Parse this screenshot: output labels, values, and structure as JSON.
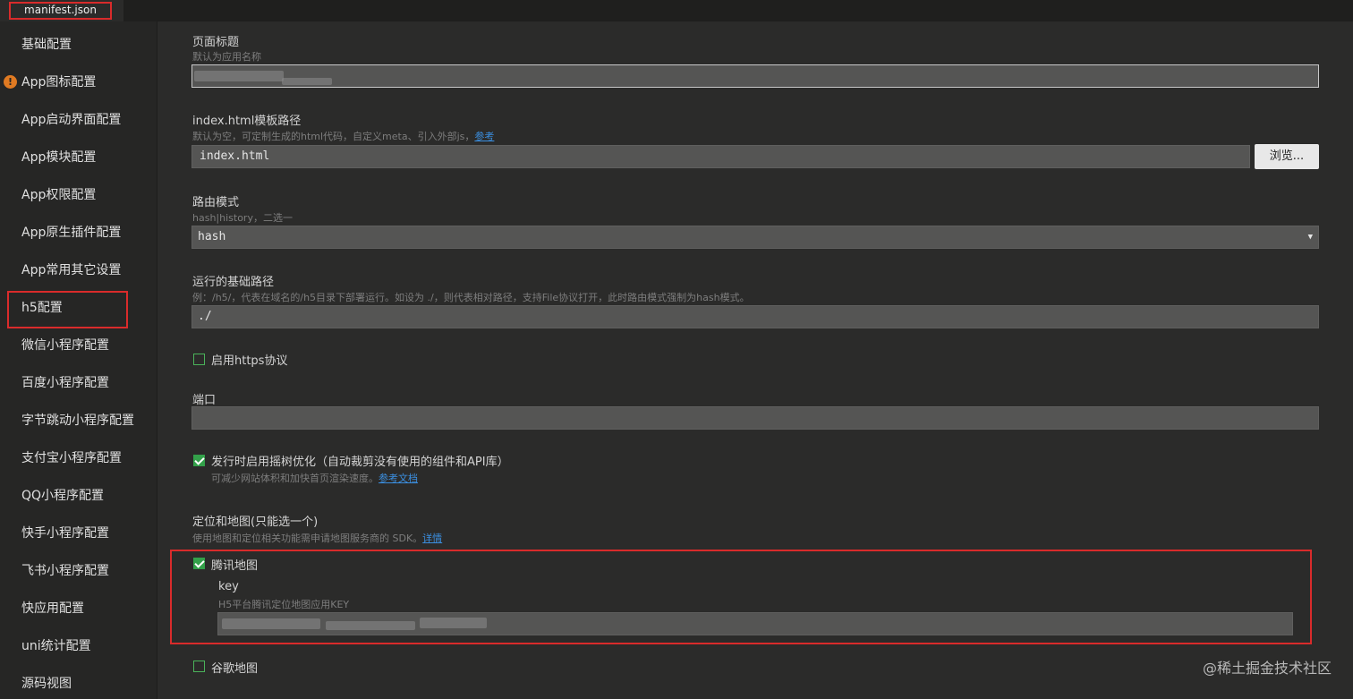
{
  "tab": {
    "label": "manifest.json"
  },
  "sidebar": {
    "items": [
      {
        "label": "基础配置"
      },
      {
        "label": "App图标配置",
        "warning": "!"
      },
      {
        "label": "App启动界面配置"
      },
      {
        "label": "App模块配置"
      },
      {
        "label": "App权限配置"
      },
      {
        "label": "App原生插件配置"
      },
      {
        "label": "App常用其它设置"
      },
      {
        "label": "h5配置",
        "selected": true
      },
      {
        "label": "微信小程序配置"
      },
      {
        "label": "百度小程序配置"
      },
      {
        "label": "字节跳动小程序配置"
      },
      {
        "label": "支付宝小程序配置"
      },
      {
        "label": "QQ小程序配置"
      },
      {
        "label": "快手小程序配置"
      },
      {
        "label": "飞书小程序配置"
      },
      {
        "label": "快应用配置"
      },
      {
        "label": "uni统计配置"
      },
      {
        "label": "源码视图"
      }
    ]
  },
  "form": {
    "title": {
      "label": "页面标题",
      "hint": "默认为应用名称",
      "value": ""
    },
    "template": {
      "label": "index.html模板路径",
      "hint": "默认为空，可定制生成的html代码，自定义meta、引入外部js，",
      "hint_link": "参考",
      "value": "index.html",
      "browse": "浏览..."
    },
    "router": {
      "label": "路由模式",
      "hint": "hash|history，二选一",
      "value": "hash"
    },
    "base": {
      "label": "运行的基础路径",
      "hint": "例：/h5/，代表在域名的/h5目录下部署运行。如设为 ./，则代表相对路径，支持File协议打开，此时路由模式强制为hash模式。",
      "value": "./"
    },
    "https": {
      "label": "启用https协议",
      "checked": false
    },
    "port": {
      "label": "端口",
      "value": ""
    },
    "treeshake": {
      "label": "发行时启用摇树优化（自动裁剪没有使用的组件和API库）",
      "hint": "可减少网站体积和加快首页渲染速度。",
      "hint_link": "参考文档",
      "checked": true
    },
    "map": {
      "label": "定位和地图(只能选一个)",
      "hint": "使用地图和定位相关功能需申请地图服务商的 SDK。",
      "hint_link": "详情"
    },
    "tencent": {
      "label": "腾讯地图",
      "checked": true,
      "key_label": "key",
      "key_hint": "H5平台腾讯定位地图应用KEY",
      "key_value": ""
    },
    "google": {
      "label": "谷歌地图",
      "checked": false
    }
  },
  "watermark": "@稀土掘金技术社区",
  "colors": {
    "accent_red": "#d92b2b",
    "check_green": "#33a14a",
    "link": "#3b8fe0"
  }
}
